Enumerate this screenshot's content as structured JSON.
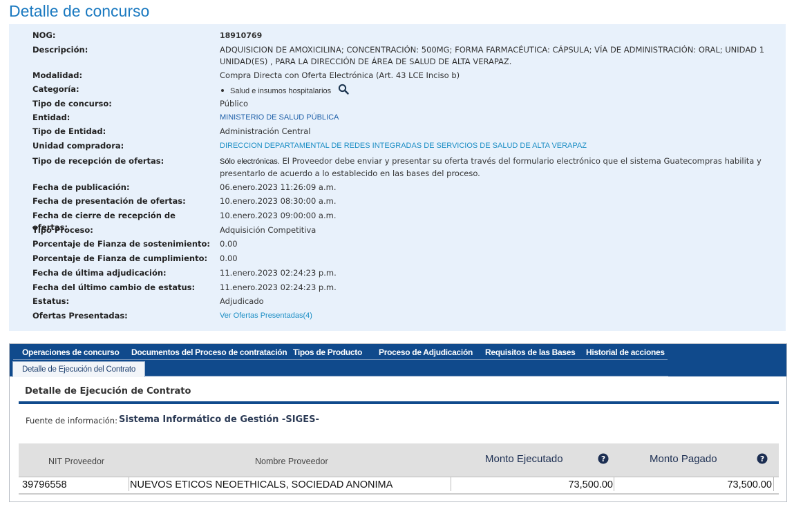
{
  "page_title": "Detalle de concurso",
  "details": [
    {
      "label": "NOG:",
      "value": "18910769"
    },
    {
      "label": "Descripción:",
      "value_line1": "ADQUISICION DE AMOXICILINA; CONCENTRACIÓN: 500MG; FORMA FARMACÉUTICA: CÁPSULA; VÍA DE ADMINISTRACIÓN: ORAL; UNIDAD 1",
      "value_line2": "UNIDAD(ES) , PARA LA DIRECCIÓN DE ÁREA DE SALUD DE ALTA VERAPAZ."
    },
    {
      "label": "Modalidad:",
      "value": "Compra Directa con Oferta Electrónica (Art. 43 LCE Inciso b)"
    },
    {
      "label": "Categoría:",
      "value": "Salud e insumos hospitalarios"
    },
    {
      "label": "Tipo de concurso:",
      "value": "Público"
    },
    {
      "label": "Entidad:",
      "value": "MINISTERIO DE SALUD PÚBLICA"
    },
    {
      "label": "Tipo de Entidad:",
      "value": "Administración Central"
    },
    {
      "label": "Unidad compradora:",
      "value": "DIRECCION DEPARTAMENTAL DE REDES INTEGRADAS DE SERVICIOS DE SALUD DE ALTA VERAPAZ"
    },
    {
      "label": "Tipo de recepción de ofertas:",
      "value_prefix": "Sólo electrónicas.",
      "value_line1": " El Proveedor debe enviar y presentar su oferta través del formulario electrónico que el sistema Guatecompras habilita y",
      "value_line2": "presentarlo de acuerdo a lo establecido en las bases del proceso."
    },
    {
      "label": "Fecha de publicación:",
      "value": "06.enero.2023 11:26:09 a.m."
    },
    {
      "label": "Fecha de presentación de ofertas:",
      "value": "10.enero.2023 08:30:00 a.m."
    },
    {
      "label": "Fecha de cierre de recepción de ofertas:",
      "value": "10.enero.2023 09:00:00 a.m."
    },
    {
      "label": "Tipo Proceso:",
      "value": "Adquisición Competitiva"
    },
    {
      "label": "Porcentaje de Fianza de sostenimiento:",
      "value": "0.00"
    },
    {
      "label": "Porcentaje de Fianza de cumplimiento:",
      "value": "0.00"
    },
    {
      "label": "Fecha de última adjudicación:",
      "value": "11.enero.2023 02:24:23 p.m."
    },
    {
      "label": "Fecha del último cambio de estatus:",
      "value": "11.enero.2023 02:24:23 p.m."
    },
    {
      "label": "Estatus:",
      "value": "Adjudicado"
    },
    {
      "label": "Ofertas Presentadas:",
      "value": "Ver Ofertas Presentadas(4)"
    }
  ],
  "tabs": [
    {
      "label": "Operaciones de concurso"
    },
    {
      "label": "Documentos del Proceso de contratación"
    },
    {
      "label": "Tipos de Producto"
    },
    {
      "label": "Proceso de Adjudicación"
    },
    {
      "label": "Requisitos de las Bases"
    },
    {
      "label": "Historial de acciones"
    }
  ],
  "active_tab": "Detalle de Ejecución del Contrato",
  "section_title": "Detalle de Ejecución de Contrato",
  "fuente": {
    "label": "Fuente de información:",
    "value": "Sistema Informático de Gestión -SIGES-"
  },
  "table": {
    "headers": {
      "nit": "NIT Proveedor",
      "nombre": "Nombre Proveedor",
      "ejecutado": "Monto Ejecutado",
      "pagado": "Monto Pagado"
    },
    "rows": [
      {
        "nit": "39796558",
        "nombre": "NUEVOS ETICOS NEOETHICALS, SOCIEDAD ANONIMA",
        "ejecutado": "73,500.00",
        "pagado": "73,500.00"
      }
    ]
  },
  "colors": {
    "title": "#1a79c0",
    "panel_bg": "#e8f1fb",
    "tabbar": "#104a8c",
    "link": "#1a8dc4",
    "entity": "#1d5fa8"
  }
}
